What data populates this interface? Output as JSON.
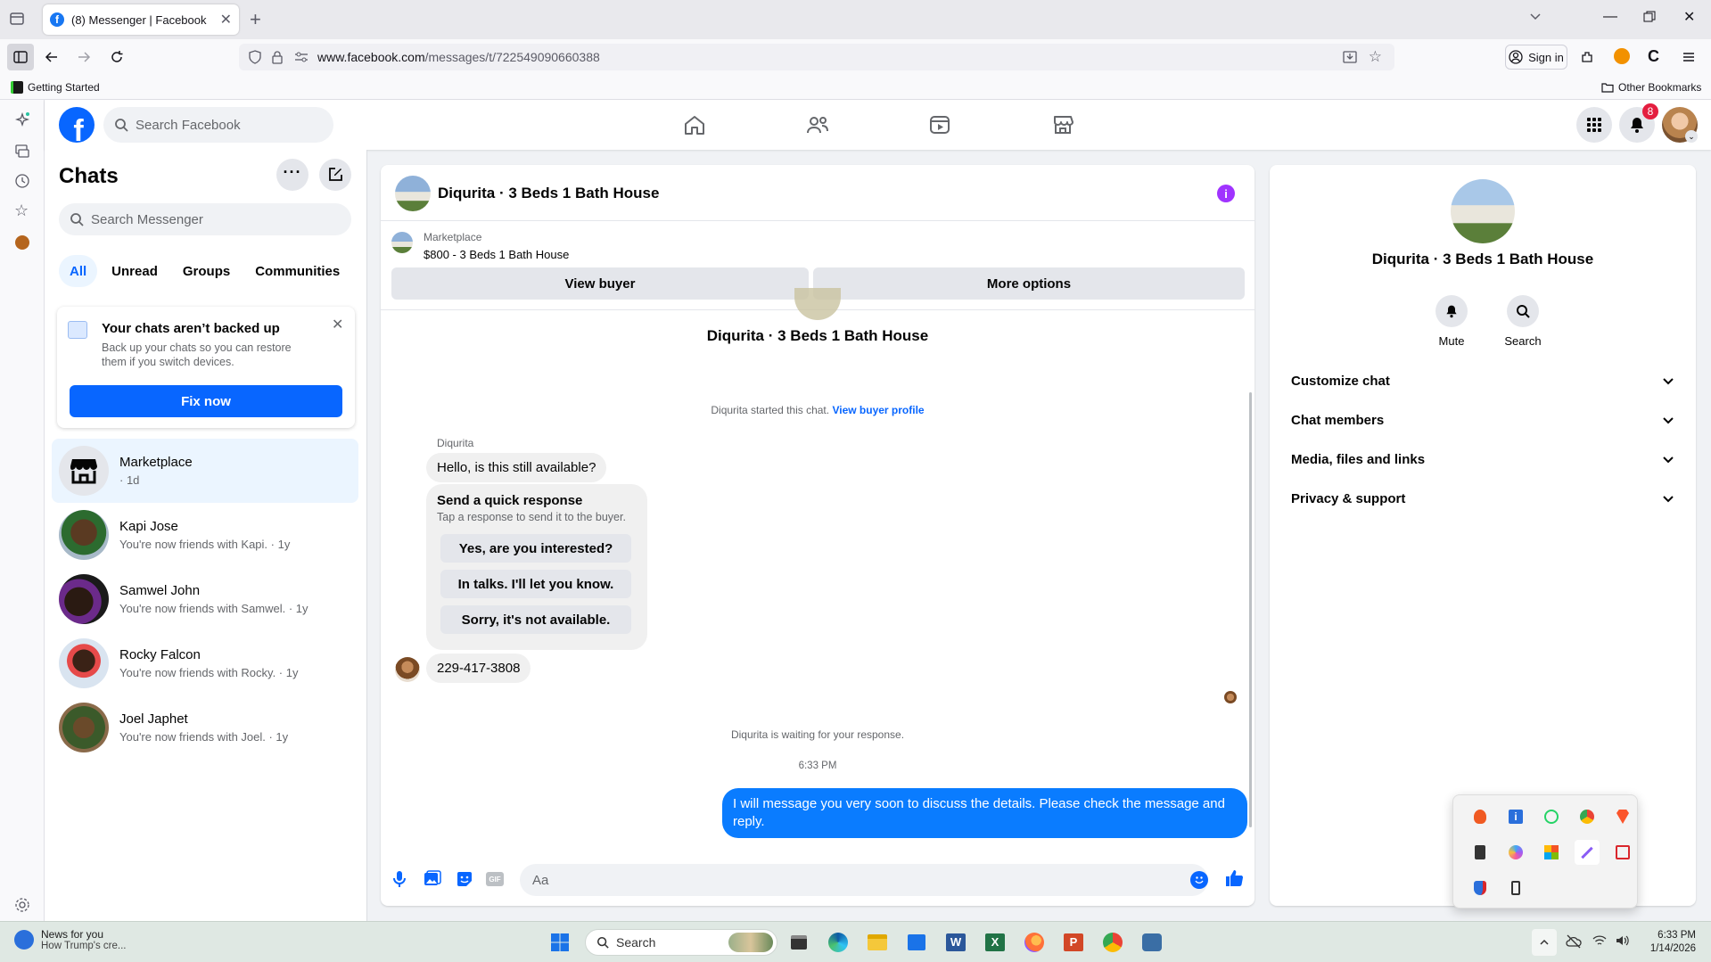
{
  "browser": {
    "tab_title": "(8) Messenger | Facebook",
    "url_host": "www.facebook.com",
    "url_path": "/messages/t/722549090660388",
    "sign_in": "Sign in",
    "bookmark_getting_started": "Getting Started",
    "bookmark_other": "Other Bookmarks"
  },
  "header": {
    "search_placeholder": "Search Facebook",
    "notification_count": "8"
  },
  "chats": {
    "title": "Chats",
    "search_placeholder": "Search Messenger",
    "filters": [
      "All",
      "Unread",
      "Groups",
      "Communities"
    ],
    "backup_title": "Your chats aren’t backed up",
    "backup_text": "Back up your chats so you can restore them if you switch devices.",
    "fix_now": "Fix now",
    "list": [
      {
        "name": "Marketplace",
        "sub": "· 1d"
      },
      {
        "name": "Kapi Jose",
        "sub": "You're now friends with Kapi. · 1y"
      },
      {
        "name": "Samwel John",
        "sub": "You're now friends with Samwel. · 1y"
      },
      {
        "name": "Rocky Falcon",
        "sub": "You're now friends with Rocky. · 1y"
      },
      {
        "name": "Joel Japhet",
        "sub": "You're now friends with Joel. · 1y"
      }
    ]
  },
  "convo": {
    "title": "Diqurita · 3 Beds 1 Bath House",
    "listing_label": "Marketplace",
    "listing_title": "$800 - 3 Beds 1 Bath House",
    "view_buyer": "View buyer",
    "more_options": "More options",
    "center_title": "Diqurita · 3 Beds 1 Bath House",
    "started_text": "Diqurita started this chat.",
    "view_buyer_profile": "View buyer profile",
    "sender": "Diqurita",
    "msg1": "Hello, is this still available?",
    "qr_title": "Send a quick response",
    "qr_sub": "Tap a response to send it to the buyer.",
    "qr_options": [
      "Yes, are you interested?",
      "In talks. I'll let you know.",
      "Sorry, it's not available."
    ],
    "msg2": "229-417-3808",
    "waiting": "Diqurita is waiting for your response.",
    "time": "6:33 PM",
    "my_msg": "I will message you very soon to discuss the details. Please check the message and reply.",
    "input_placeholder": "Aa"
  },
  "details": {
    "name": "Diqurita · 3 Beds 1 Bath House",
    "mute": "Mute",
    "search": "Search",
    "sections": [
      "Customize chat",
      "Chat members",
      "Media, files and links",
      "Privacy & support"
    ]
  },
  "taskbar": {
    "news_title": "News for you",
    "news_sub": "How Trump's cre...",
    "search": "Search",
    "clock_time": "6:33 PM",
    "clock_date": "1/14/2026"
  },
  "colors": {
    "accent": "#0866ff",
    "bubble_mine": "#0a7cff",
    "badge": "#e41e3f"
  }
}
